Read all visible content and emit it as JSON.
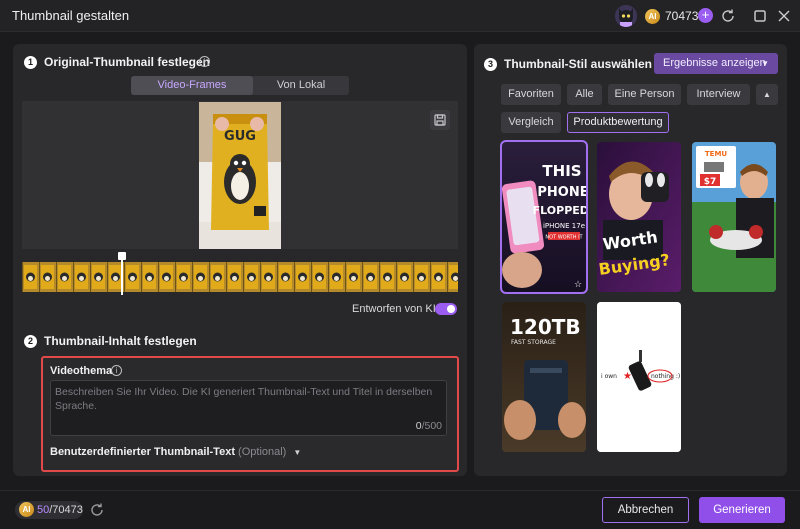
{
  "window": {
    "title": "Thumbnail gestalten",
    "credits": "70473",
    "coin_label": "AI",
    "plus_label": "+"
  },
  "step1": {
    "number": "1",
    "title": "Original-Thumbnail festlegen",
    "tabs": [
      {
        "label": "Video-Frames",
        "active": true
      },
      {
        "label": "Von Lokal",
        "active": false
      }
    ],
    "ai_toggle_label": "Entworfen von KI",
    "ai_toggle_on": true
  },
  "step2": {
    "number": "2",
    "title": "Thumbnail-Inhalt festlegen",
    "video_topic_label": "Videothema",
    "video_topic_placeholder": "Beschreiben Sie Ihr Video. Die KI generiert Thumbnail-Text und Titel in derselben Sprache.",
    "char_count": "0",
    "char_max": "/500",
    "custom_text_label": "Benutzerdefinierter Thumbnail-Text",
    "custom_text_optional": "(Optional)"
  },
  "step3": {
    "number": "3",
    "title": "Thumbnail-Stil auswählen",
    "results_button": "Ergebnisse anzeigen",
    "chips": [
      {
        "label": "Favoriten",
        "active": false
      },
      {
        "label": "Alle",
        "active": false
      },
      {
        "label": "Eine Person",
        "active": false
      },
      {
        "label": "Interview",
        "active": false
      },
      {
        "label": "Vergleich",
        "active": false
      },
      {
        "label": "Produktbewertung",
        "active": true
      }
    ],
    "cards": {
      "phone": {
        "line1": "THIS",
        "line2": "PHONE",
        "line3": "FLOPPED?",
        "line4": "iPHONE 17e",
        "line5": "NOT WORTH IT"
      },
      "worth": {
        "line1": "Worth",
        "line2": "Buying?"
      },
      "temu": {
        "brand": "TEMU",
        "price": "$7"
      },
      "storage": {
        "line1": "120TB",
        "line2": "FAST STORAGE"
      },
      "mic": {
        "left": "i own",
        "right": "nothing :)"
      }
    }
  },
  "footer": {
    "credits_used": "50",
    "credits_total": "/70473",
    "cancel_label": "Abbrechen",
    "generate_label": "Generieren"
  },
  "colors": {
    "accent": "#9b5cf0",
    "highlight_border": "#e04a4a",
    "background": "#1b1b1d",
    "panel": "#28282b"
  }
}
